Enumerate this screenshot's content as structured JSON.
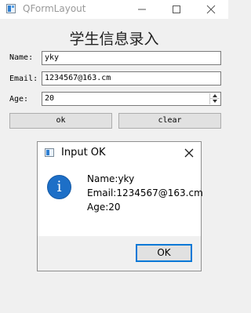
{
  "window": {
    "title": "QFormLayout"
  },
  "form": {
    "heading": "学生信息录入",
    "name_label": "Name:",
    "name_value": "yky",
    "email_label": "Email:",
    "email_value": "1234567@163.cm",
    "age_label": "Age:",
    "age_value": "20",
    "ok_label": "ok",
    "clear_label": "clear"
  },
  "dialog": {
    "title": "Input OK",
    "line1": "Name:yky",
    "line2": "Email:1234567@163.cm",
    "line3": "Age:20",
    "ok_label": "OK"
  },
  "icons": {
    "app": "qt-app-icon",
    "info": "information-icon",
    "info_glyph": "i",
    "minimize": "minimize-icon",
    "maximize": "maximize-icon",
    "close": "close-icon"
  },
  "colors": {
    "focus_border": "#0078d7",
    "info_icon": "#1d6fc7"
  }
}
